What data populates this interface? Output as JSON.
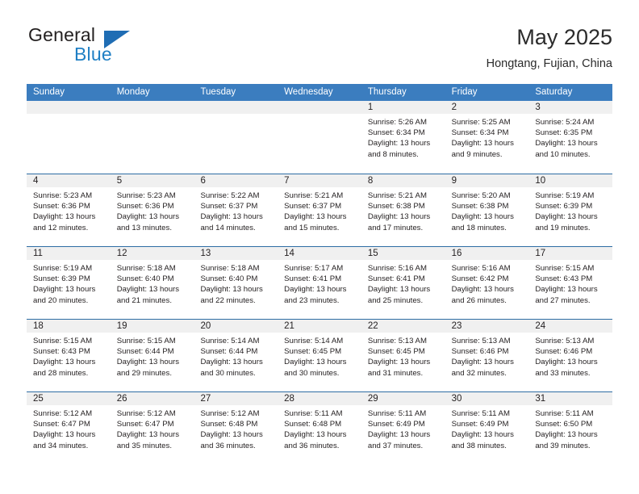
{
  "brand": {
    "name_primary": "General",
    "name_secondary": "Blue",
    "accent_color": "#1f7fc4",
    "triangle_color": "#1f6db4"
  },
  "header": {
    "title": "May 2025",
    "subtitle": "Hongtang, Fujian, China"
  },
  "calendar": {
    "header_bg": "#3b7dbf",
    "row_border": "#2e6da4",
    "daynum_bg": "#f0f0f0",
    "weekdays": [
      "Sunday",
      "Monday",
      "Tuesday",
      "Wednesday",
      "Thursday",
      "Friday",
      "Saturday"
    ],
    "weeks": [
      [
        {
          "day": "",
          "sunrise": "",
          "sunset": "",
          "daylight": "",
          "empty": true
        },
        {
          "day": "",
          "sunrise": "",
          "sunset": "",
          "daylight": "",
          "empty": true
        },
        {
          "day": "",
          "sunrise": "",
          "sunset": "",
          "daylight": "",
          "empty": true
        },
        {
          "day": "",
          "sunrise": "",
          "sunset": "",
          "daylight": "",
          "empty": true
        },
        {
          "day": "1",
          "sunrise": "Sunrise: 5:26 AM",
          "sunset": "Sunset: 6:34 PM",
          "daylight": "Daylight: 13 hours and 8 minutes."
        },
        {
          "day": "2",
          "sunrise": "Sunrise: 5:25 AM",
          "sunset": "Sunset: 6:34 PM",
          "daylight": "Daylight: 13 hours and 9 minutes."
        },
        {
          "day": "3",
          "sunrise": "Sunrise: 5:24 AM",
          "sunset": "Sunset: 6:35 PM",
          "daylight": "Daylight: 13 hours and 10 minutes."
        }
      ],
      [
        {
          "day": "4",
          "sunrise": "Sunrise: 5:23 AM",
          "sunset": "Sunset: 6:36 PM",
          "daylight": "Daylight: 13 hours and 12 minutes."
        },
        {
          "day": "5",
          "sunrise": "Sunrise: 5:23 AM",
          "sunset": "Sunset: 6:36 PM",
          "daylight": "Daylight: 13 hours and 13 minutes."
        },
        {
          "day": "6",
          "sunrise": "Sunrise: 5:22 AM",
          "sunset": "Sunset: 6:37 PM",
          "daylight": "Daylight: 13 hours and 14 minutes."
        },
        {
          "day": "7",
          "sunrise": "Sunrise: 5:21 AM",
          "sunset": "Sunset: 6:37 PM",
          "daylight": "Daylight: 13 hours and 15 minutes."
        },
        {
          "day": "8",
          "sunrise": "Sunrise: 5:21 AM",
          "sunset": "Sunset: 6:38 PM",
          "daylight": "Daylight: 13 hours and 17 minutes."
        },
        {
          "day": "9",
          "sunrise": "Sunrise: 5:20 AM",
          "sunset": "Sunset: 6:38 PM",
          "daylight": "Daylight: 13 hours and 18 minutes."
        },
        {
          "day": "10",
          "sunrise": "Sunrise: 5:19 AM",
          "sunset": "Sunset: 6:39 PM",
          "daylight": "Daylight: 13 hours and 19 minutes."
        }
      ],
      [
        {
          "day": "11",
          "sunrise": "Sunrise: 5:19 AM",
          "sunset": "Sunset: 6:39 PM",
          "daylight": "Daylight: 13 hours and 20 minutes."
        },
        {
          "day": "12",
          "sunrise": "Sunrise: 5:18 AM",
          "sunset": "Sunset: 6:40 PM",
          "daylight": "Daylight: 13 hours and 21 minutes."
        },
        {
          "day": "13",
          "sunrise": "Sunrise: 5:18 AM",
          "sunset": "Sunset: 6:40 PM",
          "daylight": "Daylight: 13 hours and 22 minutes."
        },
        {
          "day": "14",
          "sunrise": "Sunrise: 5:17 AM",
          "sunset": "Sunset: 6:41 PM",
          "daylight": "Daylight: 13 hours and 23 minutes."
        },
        {
          "day": "15",
          "sunrise": "Sunrise: 5:16 AM",
          "sunset": "Sunset: 6:41 PM",
          "daylight": "Daylight: 13 hours and 25 minutes."
        },
        {
          "day": "16",
          "sunrise": "Sunrise: 5:16 AM",
          "sunset": "Sunset: 6:42 PM",
          "daylight": "Daylight: 13 hours and 26 minutes."
        },
        {
          "day": "17",
          "sunrise": "Sunrise: 5:15 AM",
          "sunset": "Sunset: 6:43 PM",
          "daylight": "Daylight: 13 hours and 27 minutes."
        }
      ],
      [
        {
          "day": "18",
          "sunrise": "Sunrise: 5:15 AM",
          "sunset": "Sunset: 6:43 PM",
          "daylight": "Daylight: 13 hours and 28 minutes."
        },
        {
          "day": "19",
          "sunrise": "Sunrise: 5:15 AM",
          "sunset": "Sunset: 6:44 PM",
          "daylight": "Daylight: 13 hours and 29 minutes."
        },
        {
          "day": "20",
          "sunrise": "Sunrise: 5:14 AM",
          "sunset": "Sunset: 6:44 PM",
          "daylight": "Daylight: 13 hours and 30 minutes."
        },
        {
          "day": "21",
          "sunrise": "Sunrise: 5:14 AM",
          "sunset": "Sunset: 6:45 PM",
          "daylight": "Daylight: 13 hours and 30 minutes."
        },
        {
          "day": "22",
          "sunrise": "Sunrise: 5:13 AM",
          "sunset": "Sunset: 6:45 PM",
          "daylight": "Daylight: 13 hours and 31 minutes."
        },
        {
          "day": "23",
          "sunrise": "Sunrise: 5:13 AM",
          "sunset": "Sunset: 6:46 PM",
          "daylight": "Daylight: 13 hours and 32 minutes."
        },
        {
          "day": "24",
          "sunrise": "Sunrise: 5:13 AM",
          "sunset": "Sunset: 6:46 PM",
          "daylight": "Daylight: 13 hours and 33 minutes."
        }
      ],
      [
        {
          "day": "25",
          "sunrise": "Sunrise: 5:12 AM",
          "sunset": "Sunset: 6:47 PM",
          "daylight": "Daylight: 13 hours and 34 minutes."
        },
        {
          "day": "26",
          "sunrise": "Sunrise: 5:12 AM",
          "sunset": "Sunset: 6:47 PM",
          "daylight": "Daylight: 13 hours and 35 minutes."
        },
        {
          "day": "27",
          "sunrise": "Sunrise: 5:12 AM",
          "sunset": "Sunset: 6:48 PM",
          "daylight": "Daylight: 13 hours and 36 minutes."
        },
        {
          "day": "28",
          "sunrise": "Sunrise: 5:11 AM",
          "sunset": "Sunset: 6:48 PM",
          "daylight": "Daylight: 13 hours and 36 minutes."
        },
        {
          "day": "29",
          "sunrise": "Sunrise: 5:11 AM",
          "sunset": "Sunset: 6:49 PM",
          "daylight": "Daylight: 13 hours and 37 minutes."
        },
        {
          "day": "30",
          "sunrise": "Sunrise: 5:11 AM",
          "sunset": "Sunset: 6:49 PM",
          "daylight": "Daylight: 13 hours and 38 minutes."
        },
        {
          "day": "31",
          "sunrise": "Sunrise: 5:11 AM",
          "sunset": "Sunset: 6:50 PM",
          "daylight": "Daylight: 13 hours and 39 minutes."
        }
      ]
    ]
  }
}
